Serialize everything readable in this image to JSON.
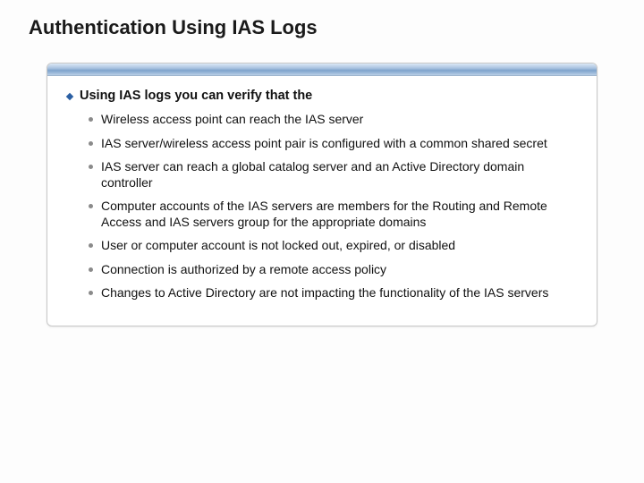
{
  "title": "Authentication Using IAS Logs",
  "lead": "Using IAS logs you can verify that the",
  "points": [
    "Wireless access point can reach the IAS server",
    "IAS server/wireless access point pair is configured with a common shared secret",
    "IAS server can reach a global catalog server and an Active Directory domain controller",
    "Computer accounts of the IAS servers are members for the Routing and Remote Access and IAS servers group for the appropriate domains",
    "User or computer account  is not locked out, expired, or disabled",
    "Connection is authorized by a remote access policy",
    "Changes to Active Directory are not impacting the functionality of the IAS servers"
  ]
}
